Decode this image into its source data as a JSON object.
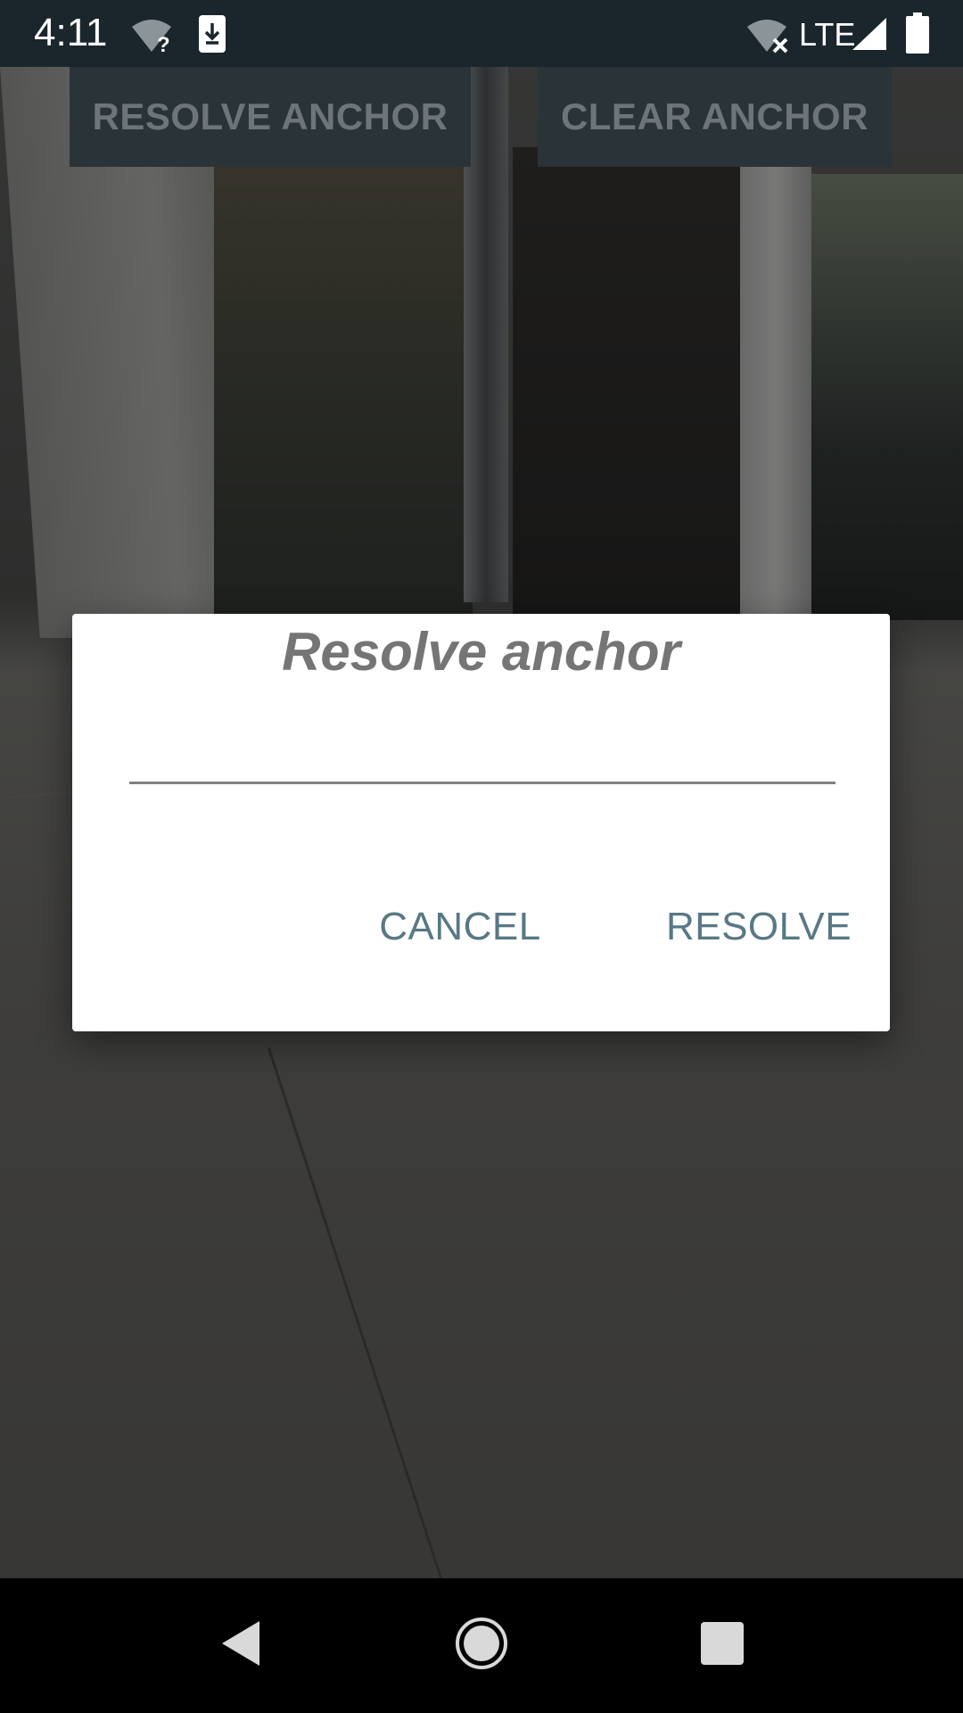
{
  "status_bar": {
    "time": "4:11",
    "network_label": "LTE",
    "icons": [
      "wifi-unknown-icon",
      "download-icon",
      "wifi-off-icon",
      "signal-icon",
      "battery-icon"
    ]
  },
  "toolbar": {
    "resolve_anchor_label": "RESOLVE ANCHOR",
    "clear_anchor_label": "CLEAR ANCHOR"
  },
  "dialog": {
    "title": "Resolve anchor",
    "input_value": "",
    "input_placeholder": "",
    "cancel_label": "CANCEL",
    "resolve_label": "RESOLVE",
    "accent_color": "#587884"
  },
  "nav_bar": {
    "icons": [
      "back-icon",
      "home-icon",
      "recents-icon"
    ]
  }
}
